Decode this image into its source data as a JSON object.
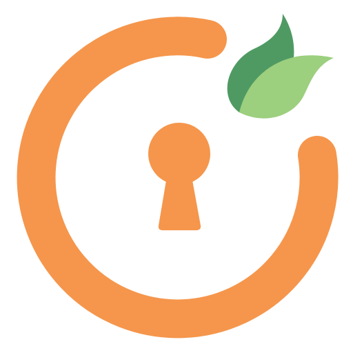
{
  "logo": {
    "icons": {
      "ring": "ring-icon",
      "keyhole": "keyhole-icon",
      "leaves": "leaves-icon"
    },
    "colors": {
      "ring": "#F5964C",
      "keyhole": "#F5964C",
      "leaf_dark": "#4F9A63",
      "leaf_light": "#9CCF7E",
      "background": "#FFFFFF"
    }
  }
}
